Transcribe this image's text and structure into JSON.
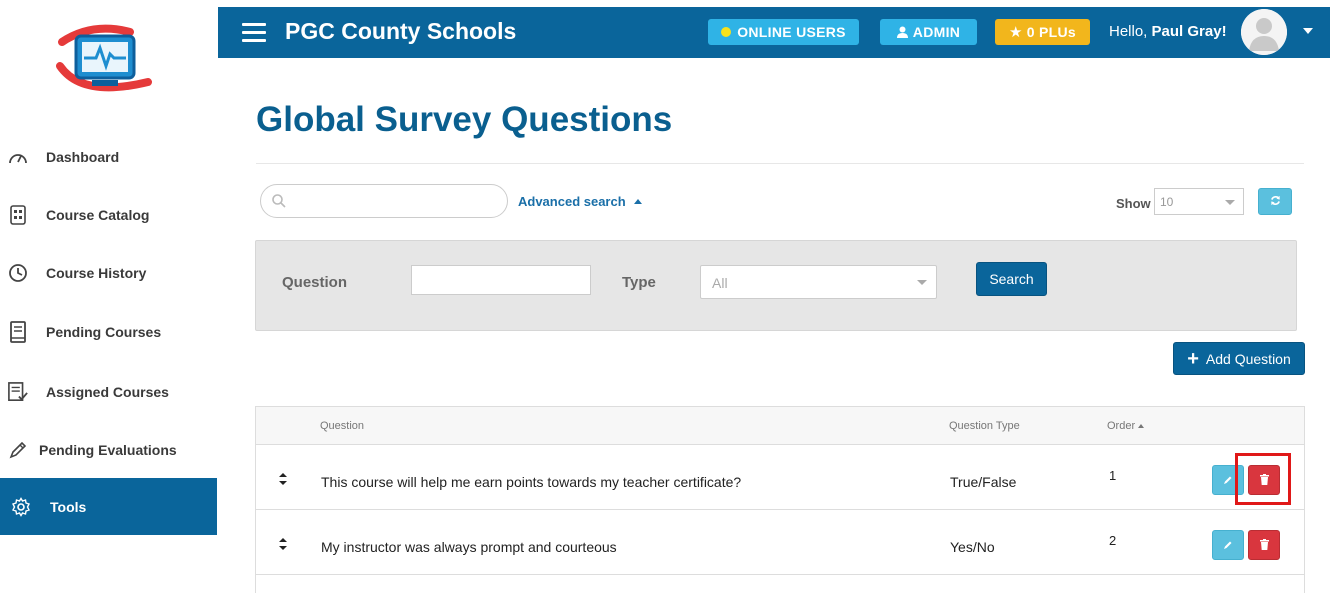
{
  "header": {
    "brand": "PGC County Schools",
    "online_users_label": "ONLINE USERS",
    "admin_label": "ADMIN",
    "plus_label": "0 PLUs",
    "greeting": "Hello,",
    "user_name": "Paul Gray!",
    "colors": {
      "topbar": "#0a659b",
      "online": "#2fb3e6",
      "plus": "#f2b61c"
    }
  },
  "sidebar": {
    "items": [
      {
        "label": "Dashboard",
        "icon": "speedometer-icon"
      },
      {
        "label": "Course Catalog",
        "icon": "catalog-icon"
      },
      {
        "label": "Course History",
        "icon": "clock-icon"
      },
      {
        "label": "Pending Courses",
        "icon": "book-icon"
      },
      {
        "label": "Assigned Courses",
        "icon": "checklist-icon"
      },
      {
        "label": "Pending Evaluations",
        "icon": "pencil-icon"
      },
      {
        "label": "Tools",
        "icon": "gear-icon",
        "active": true
      }
    ]
  },
  "page": {
    "title": "Global Survey Questions"
  },
  "search": {
    "placeholder": "",
    "advanced_label": "Advanced search"
  },
  "show": {
    "label": "Show",
    "value": "10"
  },
  "filter": {
    "question_label": "Question",
    "question_value": "",
    "type_label": "Type",
    "type_value": "All",
    "search_button": "Search"
  },
  "add_button": "Add Question",
  "table": {
    "headers": {
      "question": "Question",
      "type": "Question Type",
      "order": "Order"
    },
    "rows": [
      {
        "question": "This course will help me earn points towards my teacher certificate?",
        "type": "True/False",
        "order": "1"
      },
      {
        "question": "My instructor was always prompt and courteous",
        "type": "Yes/No",
        "order": "2"
      }
    ]
  }
}
